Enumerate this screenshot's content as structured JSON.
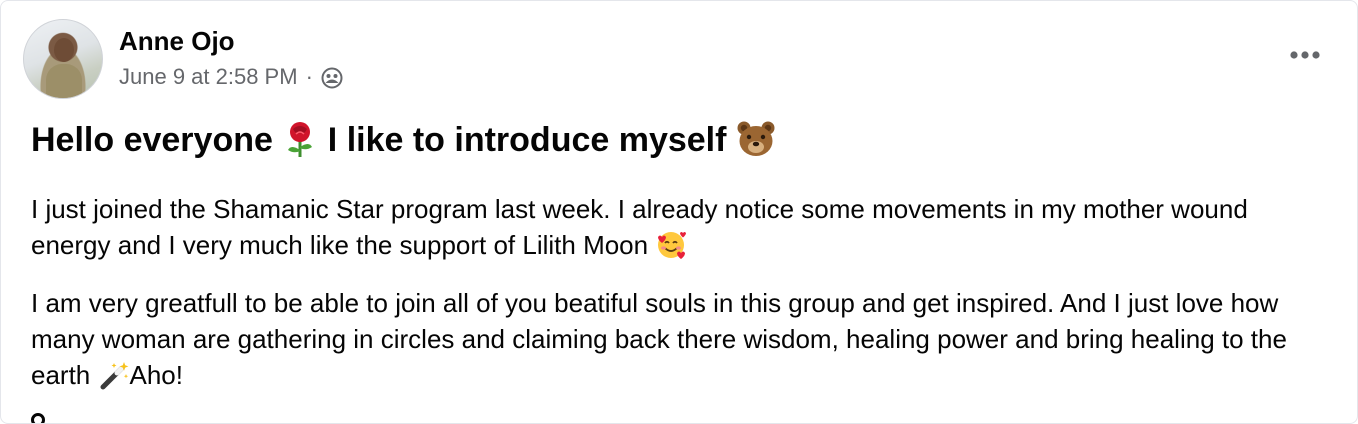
{
  "post": {
    "author": "Anne Ojo",
    "timestamp": "June 9 at 2:58 PM",
    "separator": "·",
    "audience_icon": "group-audience-icon",
    "more_icon": "more-options-icon",
    "title_part1": "Hello everyone",
    "title_emoji1": "rose-emoji",
    "title_part2": "I like to introduce myself",
    "title_emoji2": "bear-face-emoji",
    "paragraph1_text": "I just joined the Shamanic Star program last week. I already notice some movements in my mother wound energy and I very much like the support of Lilith Moon",
    "paragraph1_emoji": "smiling-face-with-hearts-emoji",
    "paragraph2_text": "I am very greatfull to be able to join all of you beatiful souls in this group and get inspired. And I just love how many woman are gathering in circles and claiming back there wisdom, healing power and bring healing to the earth",
    "paragraph2_emoji": "magic-wand-emoji",
    "paragraph2_tail": "Aho!"
  },
  "colors": {
    "primary_text": "#050505",
    "secondary_text": "#65676b",
    "border": "#e4e6eb"
  }
}
